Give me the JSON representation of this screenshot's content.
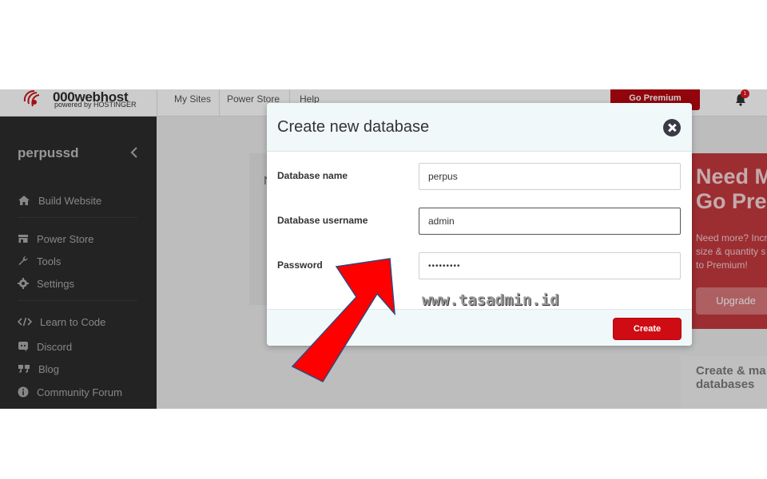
{
  "brand": {
    "name": "000webhost",
    "tagline": "powered by HOSTINGER"
  },
  "nav": {
    "links": [
      "My Sites",
      "Power Store",
      "Help"
    ],
    "premium_label": "Go Premium",
    "notification_count": "1"
  },
  "sidebar": {
    "site_name": "perpussd",
    "items": [
      {
        "label": "Build Website",
        "icon": "home-icon"
      },
      {
        "label": "Power Store",
        "icon": "store-icon"
      },
      {
        "label": "Tools",
        "icon": "wrench-icon"
      },
      {
        "label": "Settings",
        "icon": "gear-icon"
      },
      {
        "label": "Learn to Code",
        "icon": "code-icon"
      },
      {
        "label": "Discord",
        "icon": "discord-icon"
      },
      {
        "label": "Blog",
        "icon": "quote-icon"
      },
      {
        "label": "Community Forum",
        "icon": "info-icon"
      }
    ]
  },
  "background": {
    "card_letter": "N"
  },
  "promo": {
    "title_line1": "Need M",
    "title_line2": "Go Pre",
    "text_line1": "Need more? Incr",
    "text_line2": "size & quantity s",
    "text_line3": "to Premium!",
    "button_label": "Upgrade",
    "db_title_line1": "Create & ma",
    "db_title_line2": "databases"
  },
  "modal": {
    "title": "Create new database",
    "fields": [
      {
        "label": "Database name",
        "value": "perpus"
      },
      {
        "label": "Database username",
        "value": "admin"
      },
      {
        "label": "Password",
        "value": "•••••••••"
      }
    ],
    "submit_label": "Create"
  },
  "watermark": "www.tasadmin.id",
  "colors": {
    "brand_red": "#cf0c14",
    "sidebar_bg": "#2c2c2c",
    "arrow_red": "#ff0000"
  }
}
